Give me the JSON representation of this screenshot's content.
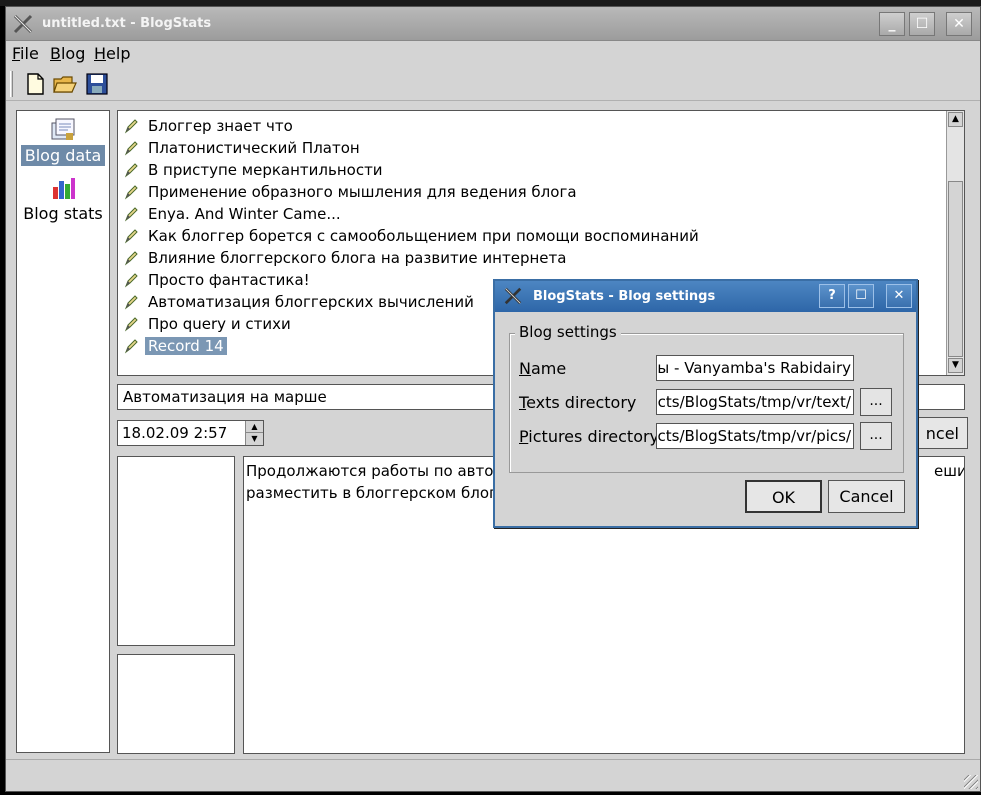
{
  "window": {
    "title": "untitled.txt - BlogStats",
    "controls": {
      "minimize": "_",
      "maximize": "☐",
      "close": "✕"
    }
  },
  "menu": {
    "file": {
      "accel": "F",
      "rest": "ile"
    },
    "blog": {
      "accel": "B",
      "rest": "log"
    },
    "help": {
      "accel": "H",
      "rest": "elp"
    }
  },
  "toolbar": {
    "icons": [
      "new-file-icon",
      "open-folder-icon",
      "save-disk-icon"
    ]
  },
  "nav": {
    "items": [
      {
        "label": "Blog data",
        "icon": "blog-data-icon",
        "selected": true
      },
      {
        "label": "Blog stats",
        "icon": "blog-stats-icon",
        "selected": false
      }
    ]
  },
  "records": [
    "Блоггер знает что",
    "Платонистический Платон",
    "В приступе меркантильности",
    "Применение образного мышления для ведения блога",
    "Enya. And Winter Came...",
    "Как блоггер борется с самообольщением при помощи воспоминаний",
    "Влияние блоггерского блога на развитие интернета",
    "Просто фантастика!",
    "Автоматизация блоггерских вычислений",
    "Про query и стихи",
    "Record 14"
  ],
  "selected_record": 10,
  "editor": {
    "title_value": "Автоматизация на марше",
    "date_value": "18.02.09 2:57",
    "cancel_fragment": "ncel",
    "body_line1": "Продолжаются работы по автом",
    "body_line1_tail": "ешил",
    "body_line2": "разместить в блоггерском блоге"
  },
  "dialog": {
    "title": "BlogStats - Blog settings",
    "controls": {
      "help": "?",
      "maximize": "☐",
      "close": "✕"
    },
    "group_title": "Blog settings",
    "name_label": {
      "accel": "N",
      "rest": "ame"
    },
    "name_value": "ы - Vanyamba's Rabidairy",
    "texts_label": {
      "accel": "T",
      "rest": "exts directory"
    },
    "texts_value": "ojects/BlogStats/tmp/vr/text/",
    "pictures_label": {
      "accel": "P",
      "rest": "ictures directory"
    },
    "pictures_value": "ects/BlogStats/tmp/vr/pics/",
    "browse_label": "...",
    "ok_label": "OK",
    "cancel_label": "Cancel"
  }
}
